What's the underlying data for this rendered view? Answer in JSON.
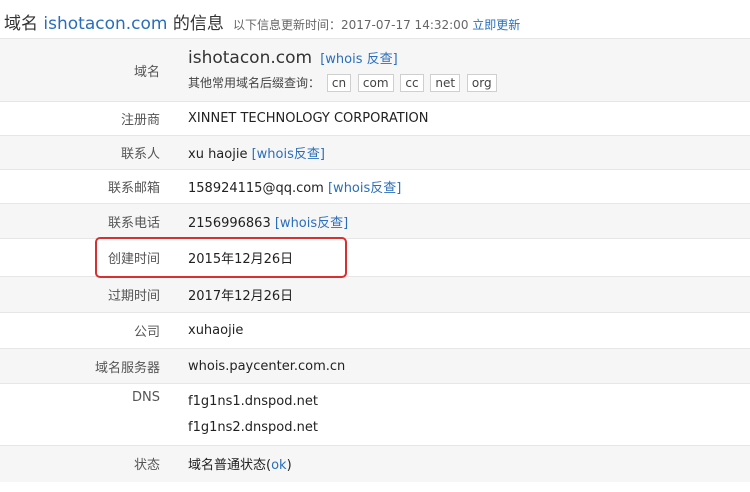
{
  "header": {
    "prefix": "域名",
    "domain": "ishotacon.com",
    "suffix": "的信息",
    "updated_label": "以下信息更新时间：",
    "updated_time": "2017-07-17 14:32:00",
    "refresh_link": "立即更新"
  },
  "rows": {
    "domain": {
      "label": "域名",
      "value": "ishotacon.com",
      "link": "[whois 反查]",
      "suffix_label": "其他常用域名后缀查询：",
      "suffixes": [
        "cn",
        "com",
        "cc",
        "net",
        "org"
      ]
    },
    "registrar": {
      "label": "注册商",
      "value": "XINNET TECHNOLOGY CORPORATION"
    },
    "contact": {
      "label": "联系人",
      "value": "xu haojie",
      "link": "[whois反查]"
    },
    "email": {
      "label": "联系邮箱",
      "value": "158924115@qq.com",
      "link": "[whois反查]"
    },
    "phone": {
      "label": "联系电话",
      "value": "2156996863",
      "link": "[whois反查]"
    },
    "created": {
      "label": "创建时间",
      "value": "2015年12月26日"
    },
    "expires": {
      "label": "过期时间",
      "value": "2017年12月26日"
    },
    "company": {
      "label": "公司",
      "value": "xuhaojie"
    },
    "nameserver": {
      "label": "域名服务器",
      "value": "whois.paycenter.com.cn"
    },
    "dns": {
      "label": "DNS",
      "values": [
        "f1g1ns1.dnspod.net",
        "f1g1ns2.dnspod.net"
      ]
    },
    "status": {
      "label": "状态",
      "value": "域名普通状态(",
      "link": "ok",
      "close": ")"
    }
  },
  "highlight_color": "#d83030",
  "link_color": "#2a6ebb"
}
